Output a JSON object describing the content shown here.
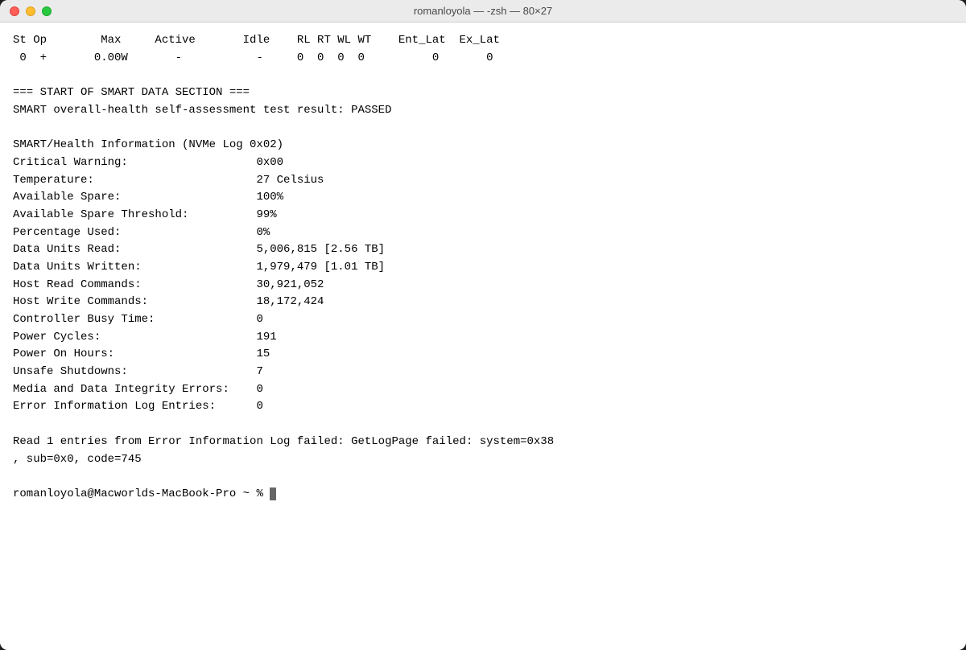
{
  "window": {
    "title": "romanloyola — -zsh — 80×27"
  },
  "terminal": {
    "lines": [
      "St Op        Max     Active       Idle    RL RT WL WT    Ent_Lat  Ex_Lat",
      " 0  +       0.00W       -           -     0  0  0  0          0       0",
      "",
      "=== START OF SMART DATA SECTION ===",
      "SMART overall-health self-assessment test result: PASSED",
      "",
      "SMART/Health Information (NVMe Log 0x02)",
      "Critical Warning:                   0x00",
      "Temperature:                        27 Celsius",
      "Available Spare:                    100%",
      "Available Spare Threshold:          99%",
      "Percentage Used:                    0%",
      "Data Units Read:                    5,006,815 [2.56 TB]",
      "Data Units Written:                 1,979,479 [1.01 TB]",
      "Host Read Commands:                 30,921,052",
      "Host Write Commands:                18,172,424",
      "Controller Busy Time:               0",
      "Power Cycles:                       191",
      "Power On Hours:                     15",
      "Unsafe Shutdowns:                   7",
      "Media and Data Integrity Errors:    0",
      "Error Information Log Entries:      0",
      "",
      "Read 1 entries from Error Information Log failed: GetLogPage failed: system=0x38",
      ", sub=0x0, code=745",
      "",
      "romanloyola@Macworlds-MacBook-Pro ~ % "
    ]
  },
  "cursor": {
    "visible": true
  }
}
